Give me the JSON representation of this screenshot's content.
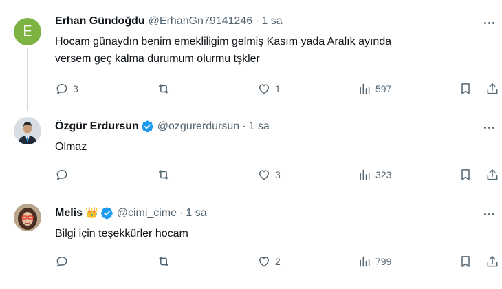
{
  "colors": {
    "text": "#0f1419",
    "muted": "#536471",
    "verified": "#1d9bf0",
    "avatar_e": "#7cb342"
  },
  "tweets": [
    {
      "avatar_letter": "E",
      "name": "Erhan Gündoğdu",
      "handle": "@ErhanGn79141246",
      "dot": "·",
      "time": "1 sa",
      "text_line1": "Hocam günaydın benim emekliligim gelmiş Kasım yada Aralık ayında",
      "text_line2": "versem geç kalma durumum olurmu tşkler",
      "replies": "3",
      "retweets": "",
      "likes": "1",
      "views": "597"
    },
    {
      "name": "Özgür Erdursun",
      "verified": true,
      "handle": "@ozgurerdursun",
      "dot": "·",
      "time": "1 sa",
      "text_line1": "Olmaz",
      "replies": "",
      "retweets": "",
      "likes": "3",
      "views": "323"
    },
    {
      "name": "Melis",
      "crown": "👑",
      "verified": true,
      "handle": "@cimi_cime",
      "dot": "·",
      "time": "1 sa",
      "text_line1": "Bilgi için teşekkürler hocam",
      "replies": "",
      "retweets": "",
      "likes": "2",
      "views": "799"
    }
  ]
}
